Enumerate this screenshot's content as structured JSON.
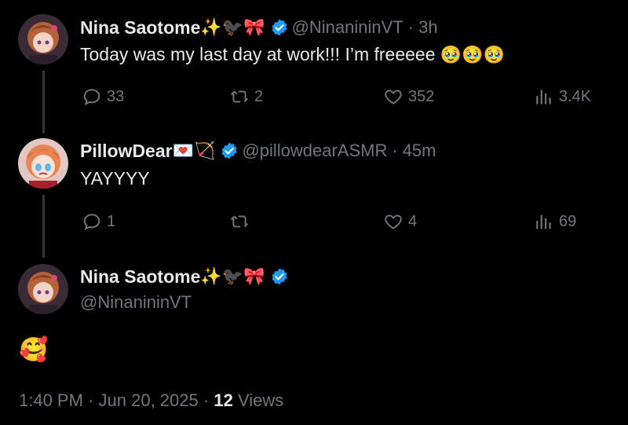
{
  "colors": {
    "background": "#000000",
    "text": "#e7e9ea",
    "muted": "#71767b",
    "verified": "#1d9bf0",
    "line": "#333639"
  },
  "tweets": [
    {
      "display_name": "Nina Saotome",
      "name_emojis": "✨🐦‍⬛🎀",
      "handle": "@NinanininVT",
      "separator": "·",
      "time": "3h",
      "text": "Today was my last day at work!!! I’m freeeee",
      "text_emojis": "🥹🥹🥹",
      "replies": "33",
      "reposts": "2",
      "likes": "352",
      "views": "3.4K"
    },
    {
      "display_name": "PillowDear",
      "name_emojis": "💌🏹",
      "handle": "@pillowdearASMR",
      "separator": "·",
      "time": "45m",
      "text": "YAYYYY",
      "replies": "1",
      "reposts": "",
      "likes": "4",
      "views": "69"
    }
  ],
  "main_post": {
    "display_name": "Nina Saotome",
    "name_emojis": "✨🐦‍⬛🎀",
    "handle": "@NinanininVT",
    "text_emoji": "🥰",
    "time": "1:40 PM",
    "date": "Jun 20, 2025",
    "separator": "·",
    "views_count": "12",
    "views_label": "Views"
  }
}
